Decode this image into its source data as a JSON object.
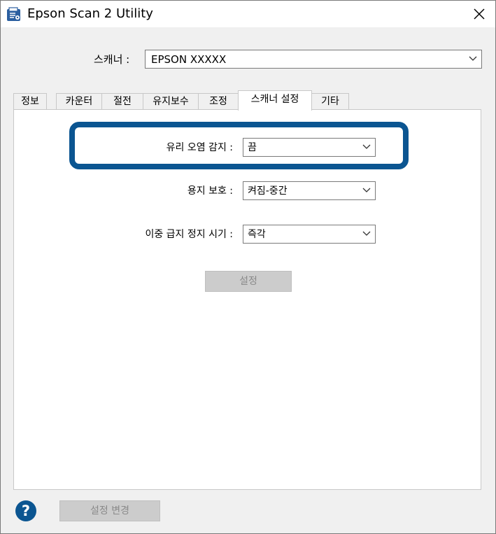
{
  "window": {
    "title": "Epson Scan 2 Utility"
  },
  "scanner": {
    "label": "스캐너 :",
    "value": "EPSON  XXXXX"
  },
  "tabs": [
    {
      "label": "정보"
    },
    {
      "label": "카운터"
    },
    {
      "label": "절전"
    },
    {
      "label": "유지보수"
    },
    {
      "label": "조정"
    },
    {
      "label": "스캐너 설정",
      "active": true
    },
    {
      "label": "기타"
    }
  ],
  "settings": {
    "glass_dirt": {
      "label": "유리 오염 감지 :",
      "value": "끔"
    },
    "paper_protection": {
      "label": "용지 보호 :",
      "value": "켜짐-중간"
    },
    "double_feed_stop": {
      "label": "이중 급지 정지 시기 :",
      "value": "즉각"
    },
    "set_button": "설정"
  },
  "footer": {
    "help_icon": "?",
    "change_settings_button": "설정 변경"
  },
  "colors": {
    "highlight": "#0b5591",
    "help_icon": "#0b5591"
  }
}
